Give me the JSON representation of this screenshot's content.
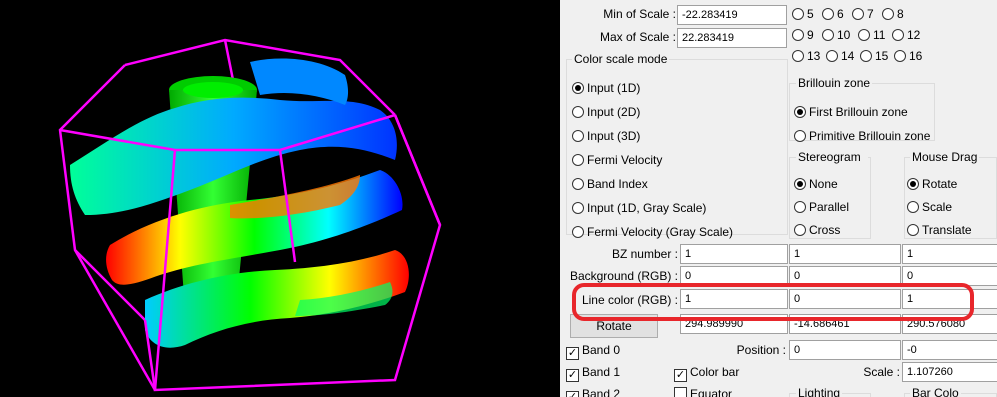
{
  "panel": {
    "scale": {
      "min_label": "Min of Scale :",
      "min_value": "-22.283419",
      "max_label": "Max of Scale :",
      "max_value": "22.283419"
    },
    "band_numbers": [
      "5",
      "6",
      "7",
      "8",
      "9",
      "10",
      "11",
      "12",
      "13",
      "14",
      "15",
      "16"
    ],
    "color_scale_mode": {
      "title": "Color scale mode",
      "options": [
        {
          "label": "Input (1D)",
          "selected": true
        },
        {
          "label": "Input (2D)",
          "selected": false
        },
        {
          "label": "Input (3D)",
          "selected": false
        },
        {
          "label": "Fermi Velocity",
          "selected": false
        },
        {
          "label": "Band Index",
          "selected": false
        },
        {
          "label": "Input (1D, Gray Scale)",
          "selected": false
        },
        {
          "label": "Fermi Velocity (Gray Scale)",
          "selected": false
        }
      ]
    },
    "brillouin_zone": {
      "title": "Brillouin zone",
      "options": [
        {
          "label": "First Brillouin zone",
          "selected": true
        },
        {
          "label": "Primitive Brillouin zone",
          "selected": false
        }
      ]
    },
    "stereogram": {
      "title": "Stereogram",
      "options": [
        {
          "label": "None",
          "selected": true
        },
        {
          "label": "Parallel",
          "selected": false
        },
        {
          "label": "Cross",
          "selected": false
        }
      ]
    },
    "mouse_drag": {
      "title": "Mouse Drag",
      "options": [
        {
          "label": "Rotate",
          "selected": true
        },
        {
          "label": "Scale",
          "selected": false
        },
        {
          "label": "Translate",
          "selected": false
        }
      ]
    },
    "bz_number": {
      "label": "BZ number :",
      "values": [
        "1",
        "1",
        "1"
      ]
    },
    "background": {
      "label": "Background (RGB) :",
      "values": [
        "0",
        "0",
        "0"
      ]
    },
    "line_color": {
      "label": "Line color (RGB) :",
      "values": [
        "1",
        "0",
        "1"
      ]
    },
    "rotate": {
      "button": "Rotate",
      "values": [
        "294.989990",
        "-14.686461",
        "290.576080"
      ]
    },
    "position": {
      "label": "Position :",
      "values": [
        "0",
        "-0"
      ]
    },
    "scale_field": {
      "label": "Scale :",
      "value": "1.107260"
    },
    "checks": [
      {
        "label": "Band 0",
        "checked": true
      },
      {
        "label": "Band 1",
        "checked": true
      },
      {
        "label": "Band 2",
        "checked": true
      },
      {
        "label": "Color bar",
        "checked": true
      },
      {
        "label": "Equator",
        "checked": false
      }
    ],
    "bottom_groups": {
      "lighting": "Lighting",
      "bar_color": "Bar Colo"
    }
  },
  "colors": {
    "bz_line": "#ff00ff",
    "highlight": "#e8262b"
  }
}
